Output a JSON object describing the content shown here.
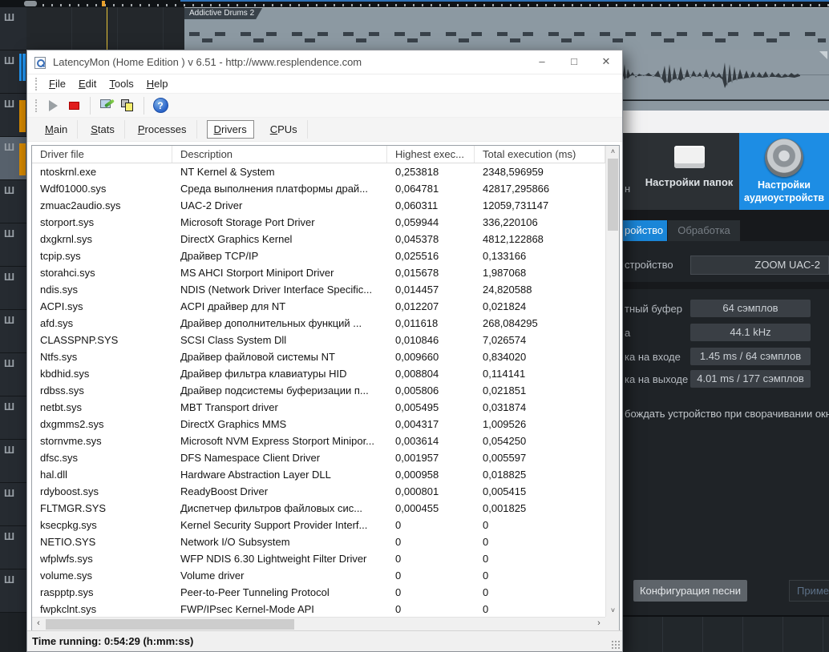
{
  "daw": {
    "clip_label": "Addictive Drums 2",
    "left_label_fragment": "н",
    "folders_button_label": "Настройки папок",
    "audio_button_line1": "Настройки",
    "audio_button_line2": "аудиоустройств",
    "accent_blue": "#1d8de4",
    "tabs": {
      "device": "ройство",
      "processing": "Обработка"
    },
    "device_row": {
      "label": "стройство",
      "value": "ZOOM UAC-2"
    },
    "fields": [
      {
        "label": "тный буфер",
        "value": "64 сэмплов"
      },
      {
        "label": "а",
        "value": "44.1 kHz"
      },
      {
        "label": "ка на входе",
        "value": "1.45 ms / 64 сэмплов"
      },
      {
        "label": "ка на выходе",
        "value": "4.01 ms / 177 сэмплов"
      }
    ],
    "release_checkbox_label": "бождать устройство при сворачивании окна",
    "song_config_button": "Конфигурация песни",
    "apply_button": "Приме",
    "tracks": [
      {
        "bar": "none",
        "selected": false
      },
      {
        "bar": "blue",
        "selected": false
      },
      {
        "bar": "orange",
        "selected": false
      },
      {
        "bar": "orange",
        "selected": true
      },
      {
        "bar": "none",
        "selected": false
      },
      {
        "bar": "none",
        "selected": false
      },
      {
        "bar": "none",
        "selected": false
      },
      {
        "bar": "none",
        "selected": false
      },
      {
        "bar": "none",
        "selected": false
      },
      {
        "bar": "none",
        "selected": false
      },
      {
        "bar": "none",
        "selected": false
      },
      {
        "bar": "none",
        "selected": false
      },
      {
        "bar": "none",
        "selected": false
      },
      {
        "bar": "none",
        "selected": false
      }
    ],
    "track_icon": "Ш"
  },
  "latencymon": {
    "title": "LatencyMon  (Home Edition )  v 6.51 - http://www.resplendence.com",
    "window_controls": {
      "minimize": "–",
      "maximize": "□",
      "close": "✕"
    },
    "menu": [
      "File",
      "Edit",
      "Tools",
      "Help"
    ],
    "tabs": [
      "Main",
      "Stats",
      "Processes",
      "Drivers",
      "CPUs"
    ],
    "active_tab": "Drivers",
    "columns": [
      "Driver file",
      "Description",
      "Highest exec...",
      "Total execution (ms)"
    ],
    "rows": [
      {
        "file": "ntoskrnl.exe",
        "desc": "NT Kernel & System",
        "high": "0,253818",
        "total": "2348,596959"
      },
      {
        "file": "Wdf01000.sys",
        "desc": "Среда выполнения платформы драй...",
        "high": "0,064781",
        "total": "42817,295866"
      },
      {
        "file": "zmuac2audio.sys",
        "desc": "UAC-2 Driver",
        "high": "0,060311",
        "total": "12059,731147"
      },
      {
        "file": "storport.sys",
        "desc": "Microsoft Storage Port Driver",
        "high": "0,059944",
        "total": "336,220106"
      },
      {
        "file": "dxgkrnl.sys",
        "desc": "DirectX Graphics Kernel",
        "high": "0,045378",
        "total": "4812,122868"
      },
      {
        "file": "tcpip.sys",
        "desc": "Драйвер TCP/IP",
        "high": "0,025516",
        "total": "0,133166"
      },
      {
        "file": "storahci.sys",
        "desc": "MS AHCI Storport Miniport Driver",
        "high": "0,015678",
        "total": "1,987068"
      },
      {
        "file": "ndis.sys",
        "desc": "NDIS (Network Driver Interface Specific...",
        "high": "0,014457",
        "total": "24,820588"
      },
      {
        "file": "ACPI.sys",
        "desc": "ACPI драйвер для NT",
        "high": "0,012207",
        "total": "0,021824"
      },
      {
        "file": "afd.sys",
        "desc": "Драйвер дополнительных функций ...",
        "high": "0,011618",
        "total": "268,084295"
      },
      {
        "file": "CLASSPNP.SYS",
        "desc": "SCSI Class System Dll",
        "high": "0,010846",
        "total": "7,026574"
      },
      {
        "file": "Ntfs.sys",
        "desc": "Драйвер файловой системы NT",
        "high": "0,009660",
        "total": "0,834020"
      },
      {
        "file": "kbdhid.sys",
        "desc": "Драйвер фильтра клавиатуры HID",
        "high": "0,008804",
        "total": "0,114141"
      },
      {
        "file": "rdbss.sys",
        "desc": "Драйвер подсистемы буферизации п...",
        "high": "0,005806",
        "total": "0,021851"
      },
      {
        "file": "netbt.sys",
        "desc": "MBT Transport driver",
        "high": "0,005495",
        "total": "0,031874"
      },
      {
        "file": "dxgmms2.sys",
        "desc": "DirectX Graphics MMS",
        "high": "0,004317",
        "total": "1,009526"
      },
      {
        "file": "stornvme.sys",
        "desc": "Microsoft NVM Express Storport Minipor...",
        "high": "0,003614",
        "total": "0,054250"
      },
      {
        "file": "dfsc.sys",
        "desc": "DFS Namespace Client Driver",
        "high": "0,001957",
        "total": "0,005597"
      },
      {
        "file": "hal.dll",
        "desc": "Hardware Abstraction Layer DLL",
        "high": "0,000958",
        "total": "0,018825"
      },
      {
        "file": "rdyboost.sys",
        "desc": "ReadyBoost Driver",
        "high": "0,000801",
        "total": "0,005415"
      },
      {
        "file": "FLTMGR.SYS",
        "desc": "Диспетчер фильтров файловых сис...",
        "high": "0,000455",
        "total": "0,001825"
      },
      {
        "file": "ksecpkg.sys",
        "desc": "Kernel Security Support Provider Interf...",
        "high": "0",
        "total": "0"
      },
      {
        "file": "NETIO.SYS",
        "desc": "Network I/O Subsystem",
        "high": "0",
        "total": "0"
      },
      {
        "file": "wfplwfs.sys",
        "desc": "WFP NDIS 6.30 Lightweight Filter Driver",
        "high": "0",
        "total": "0"
      },
      {
        "file": "volume.sys",
        "desc": "Volume driver",
        "high": "0",
        "total": "0"
      },
      {
        "file": "raspptp.sys",
        "desc": "Peer-to-Peer Tunneling Protocol",
        "high": "0",
        "total": "0"
      },
      {
        "file": "fwpkclnt.sys",
        "desc": "FWP/IPsec Kernel-Mode API",
        "high": "0",
        "total": "0"
      }
    ],
    "status": "Time running: 0:54:29  (h:mm:ss)"
  }
}
